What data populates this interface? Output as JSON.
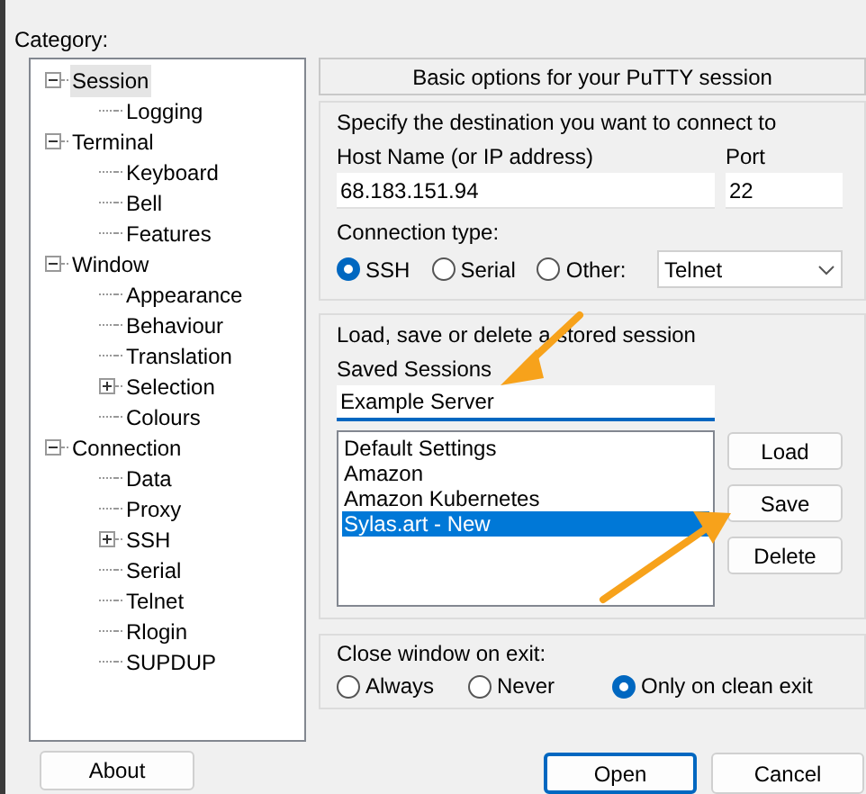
{
  "category_label": "Category:",
  "tree": [
    {
      "label": "Session",
      "selected": true,
      "expanded": true,
      "children": [
        {
          "label": "Logging",
          "selected": false
        }
      ]
    },
    {
      "label": "Terminal",
      "selected": false,
      "expanded": true,
      "children": [
        {
          "label": "Keyboard",
          "selected": false
        },
        {
          "label": "Bell",
          "selected": false
        },
        {
          "label": "Features",
          "selected": false
        }
      ]
    },
    {
      "label": "Window",
      "selected": false,
      "expanded": true,
      "children": [
        {
          "label": "Appearance",
          "selected": false
        },
        {
          "label": "Behaviour",
          "selected": false
        },
        {
          "label": "Translation",
          "selected": false
        },
        {
          "label": "Selection",
          "selected": false,
          "expanded": false
        },
        {
          "label": "Colours",
          "selected": false
        }
      ]
    },
    {
      "label": "Connection",
      "selected": false,
      "expanded": true,
      "children": [
        {
          "label": "Data",
          "selected": false
        },
        {
          "label": "Proxy",
          "selected": false
        },
        {
          "label": "SSH",
          "selected": false,
          "expanded": false
        },
        {
          "label": "Serial",
          "selected": false
        },
        {
          "label": "Telnet",
          "selected": false
        },
        {
          "label": "Rlogin",
          "selected": false
        },
        {
          "label": "SUPDUP",
          "selected": false
        }
      ]
    }
  ],
  "panel_title": "Basic options for your PuTTY session",
  "destination": {
    "legend": "Specify the destination you want to connect to",
    "host_label": "Host Name (or IP address)",
    "host_value": "68.183.151.94",
    "port_label": "Port",
    "port_value": "22",
    "type_label": "Connection type:",
    "types": [
      {
        "label": "SSH",
        "selected": true
      },
      {
        "label": "Serial",
        "selected": false
      },
      {
        "label": "Other:",
        "selected": false
      }
    ],
    "other_value": "Telnet"
  },
  "sessions": {
    "legend": "Load, save or delete a stored session",
    "label": "Saved Sessions",
    "value": "Example Server",
    "items": [
      {
        "label": "Default Settings",
        "selected": false
      },
      {
        "label": "Amazon",
        "selected": false
      },
      {
        "label": "Amazon Kubernetes",
        "selected": false
      },
      {
        "label": "Sylas.art - New",
        "selected": true
      }
    ],
    "buttons": [
      "Load",
      "Save",
      "Delete"
    ]
  },
  "close": {
    "label": "Close window on exit:",
    "options": [
      {
        "label": "Always",
        "selected": false
      },
      {
        "label": "Never",
        "selected": false
      },
      {
        "label": "Only on clean exit",
        "selected": true
      }
    ]
  },
  "about_button": "About",
  "buttons": [
    {
      "label": "Open",
      "default": true
    },
    {
      "label": "Cancel",
      "default": false
    }
  ]
}
